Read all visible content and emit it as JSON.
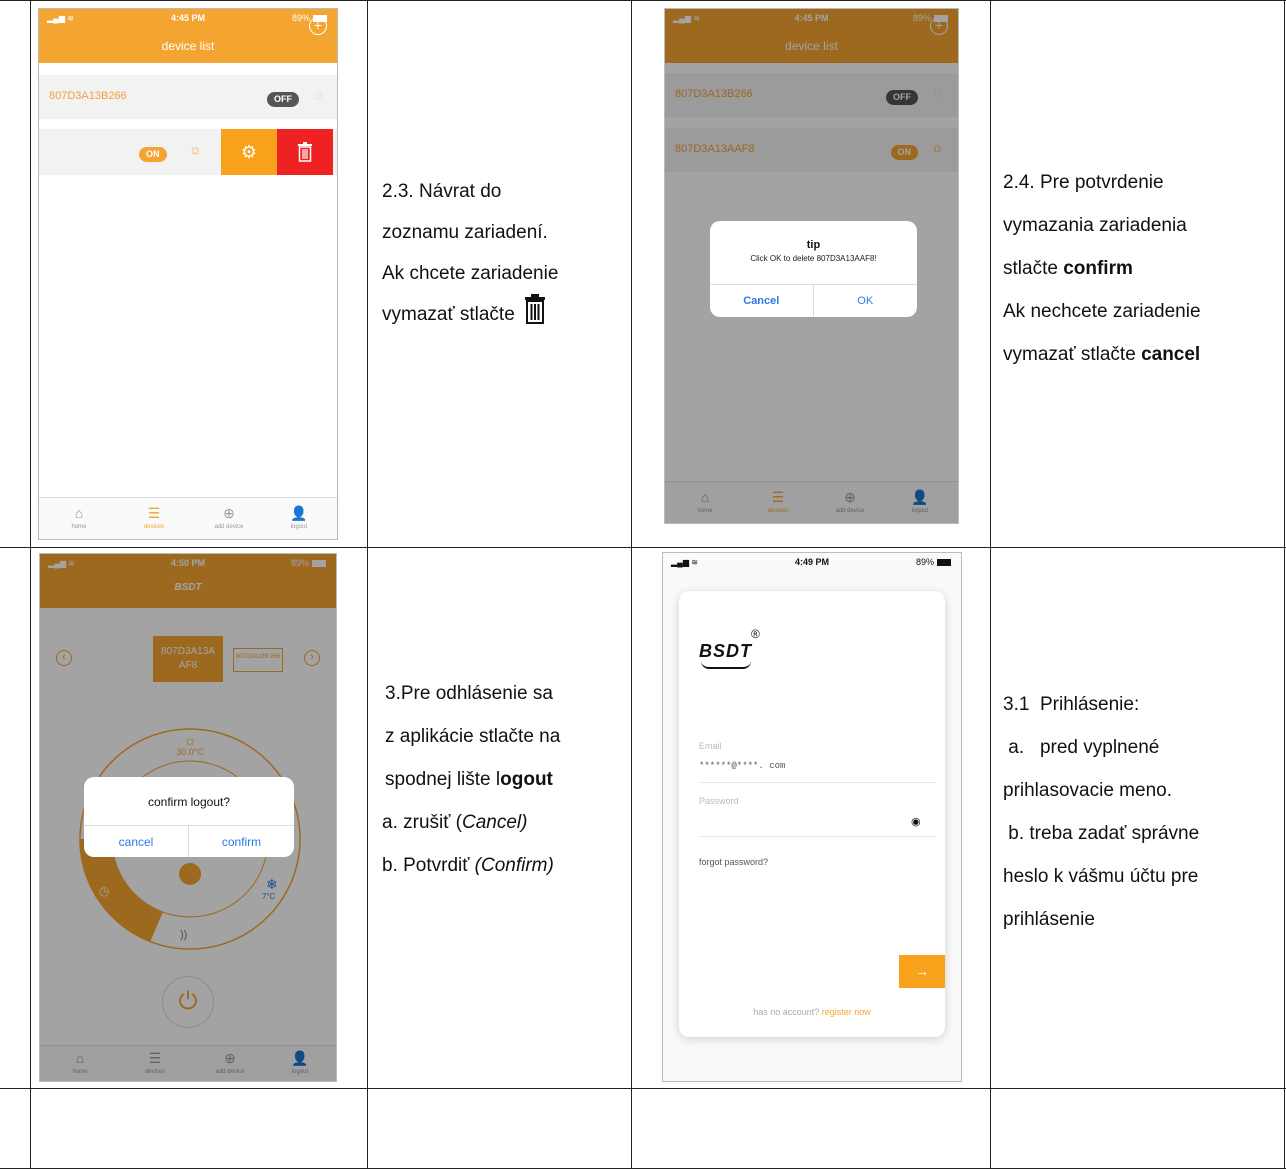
{
  "colors": {
    "orange": "#f4a431",
    "red": "#ee2222",
    "blue": "#2c7be5"
  },
  "phone1": {
    "time": "4:45 PM",
    "battery": "89%",
    "title": "device list",
    "row1": {
      "id": "807D3A13B266",
      "state": "OFF"
    },
    "row2": {
      "state": "ON"
    },
    "tabs": [
      "home",
      "devices",
      "add device",
      "logout"
    ]
  },
  "desc1": {
    "lines": [
      "2.3. Návrat do",
      "zoznamu zariadení.",
      "Ak chcete zariadenie"
    ],
    "last": "vymazať stlačte"
  },
  "phone2": {
    "time": "4:45 PM",
    "battery": "89%",
    "title": "device list",
    "row1": {
      "id": "807D3A13B266",
      "state": "OFF"
    },
    "row2": {
      "id": "807D3A13AAF8",
      "state": "ON"
    },
    "dialog": {
      "title": "tip",
      "message": "Click OK to delete 807D3A13AAF8!",
      "cancel": "Cancel",
      "ok": "OK"
    },
    "tabs": [
      "home",
      "devices",
      "add device",
      "logout"
    ]
  },
  "desc2": {
    "line1": "2.4. Pre potvrdenie",
    "line2": "vymazania zariadenia",
    "line3_pre": "stlačte ",
    "line3_bold": "confirm",
    "line4": "Ak nechcete zariadenie",
    "line5_pre": "vymazať stlačte ",
    "line5_bold": "cancel"
  },
  "phone3": {
    "time": "4:50 PM",
    "battery": "89%",
    "logo": "BSDT",
    "dev_active": "807D3A13A AF8",
    "dev_other": "807D3A13B 266",
    "temp": "30.0°C",
    "cool": "7°C",
    "dialog": {
      "title": "confirm logout?",
      "cancel": "cancel",
      "confirm": "confirm"
    },
    "tabs": [
      "home",
      "devices",
      "add device",
      "logout"
    ]
  },
  "desc3": {
    "line1": "3.Pre odhlásenie sa",
    "line2": "z aplikácie stlačte na",
    "line3_pre": "spodnej lište l",
    "line3_bold": "ogout",
    "line4_pre": "a. zrušiť (",
    "line4_italic": "Cancel)",
    "line5_pre": "b. Potvrdiť ",
    "line5_italic": "(Confirm)"
  },
  "phone4": {
    "time": "4:49 PM",
    "battery": "89%",
    "logo": "BSDT",
    "email_label": "Email",
    "email_value": "******@****. com",
    "password_label": "Password",
    "forgot": "forgot password?",
    "no_account": "has no account?",
    "register": "register now"
  },
  "desc4": {
    "line1": "3.1  Prihlásenie:",
    "line2": " a.   pred vyplnené",
    "line3": "prihlasovacie meno.",
    "line4": " b. treba zadať správne",
    "line5": "heslo k vášmu účtu pre",
    "line6": "prihlásenie"
  }
}
